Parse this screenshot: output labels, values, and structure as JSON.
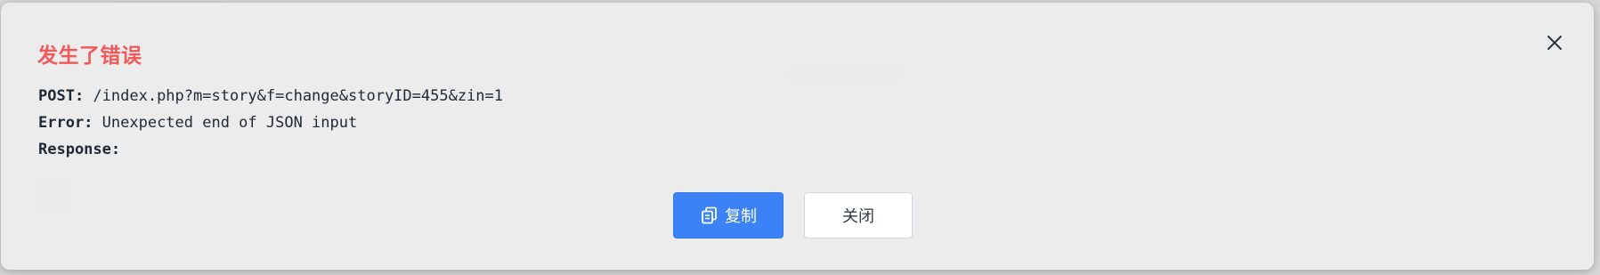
{
  "dialog": {
    "title": "发生了错误",
    "title_color": "#ef5a5a",
    "close_icon": "close-icon",
    "details": [
      {
        "key": "POST:",
        "value": " /index.php?m=story&f=change&storyID=455&zin=1"
      },
      {
        "key": "Error:",
        "value": " Unexpected end of JSON input"
      },
      {
        "key": "Response:",
        "value": ""
      }
    ],
    "buttons": {
      "copy_label": "复制",
      "copy_icon": "copy-icon",
      "close_label": "关闭"
    },
    "accent_color": "#3b82f6"
  }
}
